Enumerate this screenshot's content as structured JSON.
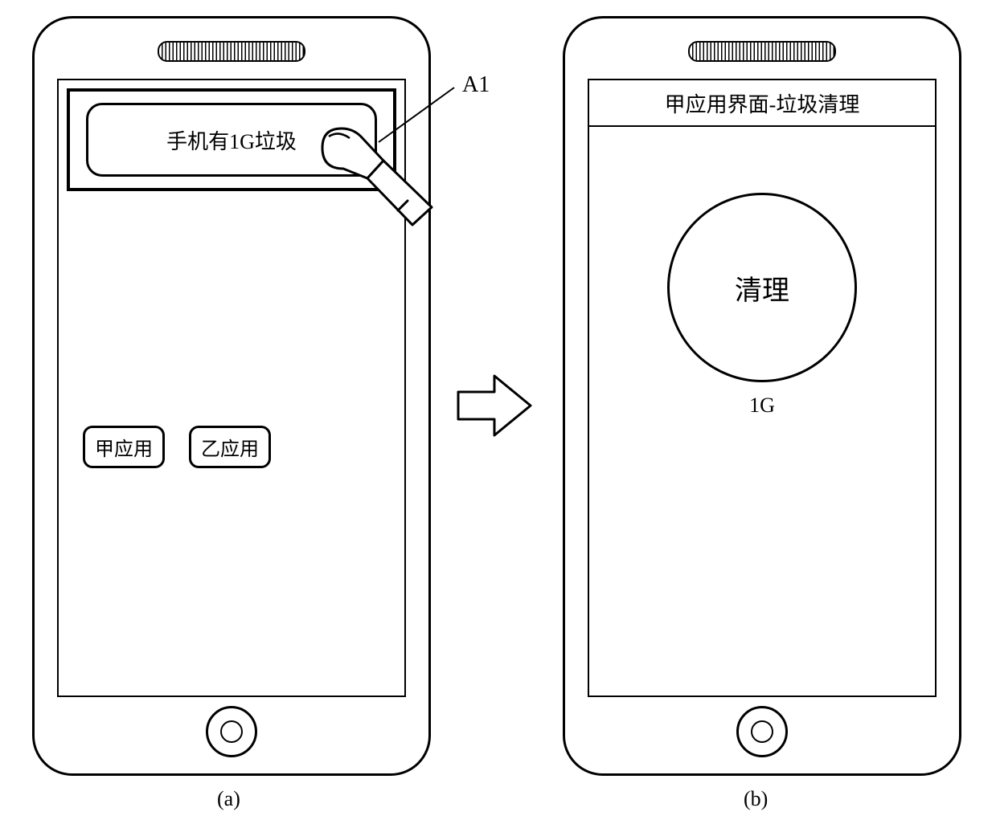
{
  "phone_a": {
    "notification_text": "手机有1G垃圾",
    "apps": [
      {
        "label": "甲应用"
      },
      {
        "label": "乙应用"
      }
    ],
    "callout_label": "A1",
    "caption": "(a)"
  },
  "phone_b": {
    "title": "甲应用界面-垃圾清理",
    "clean_button_label": "清理",
    "junk_size_label": "1G",
    "caption": "(b)"
  }
}
